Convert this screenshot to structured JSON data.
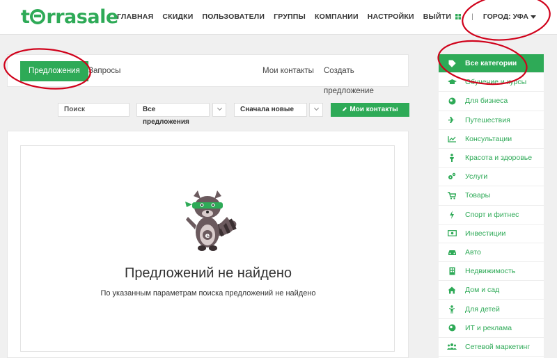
{
  "header": {
    "logo": "terrasale",
    "nav": [
      "ГЛАВНАЯ",
      "СКИДКИ",
      "ПОЛЬЗОВАТЕЛИ",
      "ГРУППЫ",
      "КОМПАНИИ",
      "НАСТРОЙКИ",
      "ВЫЙТИ"
    ],
    "separator": "|",
    "city_label": "ГОРОД: УФА"
  },
  "tabs": {
    "offers": "Предложения",
    "requests": "Запросы",
    "my_contacts": "Мои контакты",
    "create_offer": "Создать предложение"
  },
  "filters": {
    "search_placeholder": "Поиск",
    "scope_select": "Все предложения",
    "sort_select": "Сначала новые",
    "my_contacts_button": "Мои контакты"
  },
  "empty_state": {
    "title": "Предложений не найдено",
    "subtitle": "По указанным параметрам поиска предложений не найдено"
  },
  "sidebar": {
    "categories": [
      {
        "label": "Все категории",
        "icon": "tag-icon",
        "active": true
      },
      {
        "label": "Обучение и курсы",
        "icon": "graduation-cap-icon"
      },
      {
        "label": "Для бизнеса",
        "icon": "globe-icon"
      },
      {
        "label": "Путешествия",
        "icon": "plane-icon"
      },
      {
        "label": "Консультации",
        "icon": "chart-line-icon"
      },
      {
        "label": "Красота и здоровье",
        "icon": "person-icon"
      },
      {
        "label": "Услуги",
        "icon": "gears-icon"
      },
      {
        "label": "Товары",
        "icon": "cart-icon"
      },
      {
        "label": "Спорт и фитнес",
        "icon": "bolt-icon"
      },
      {
        "label": "Инвестиции",
        "icon": "money-icon"
      },
      {
        "label": "Авто",
        "icon": "car-icon"
      },
      {
        "label": "Недвижимость",
        "icon": "building-icon"
      },
      {
        "label": "Дом и сад",
        "icon": "home-icon"
      },
      {
        "label": "Для детей",
        "icon": "child-icon"
      },
      {
        "label": "ИТ и реклама",
        "icon": "globe-icon"
      },
      {
        "label": "Сетевой маркетинг",
        "icon": "users-icon"
      }
    ]
  },
  "colors": {
    "brand_green": "#2eaa57",
    "annotation_red": "#d0021b"
  }
}
